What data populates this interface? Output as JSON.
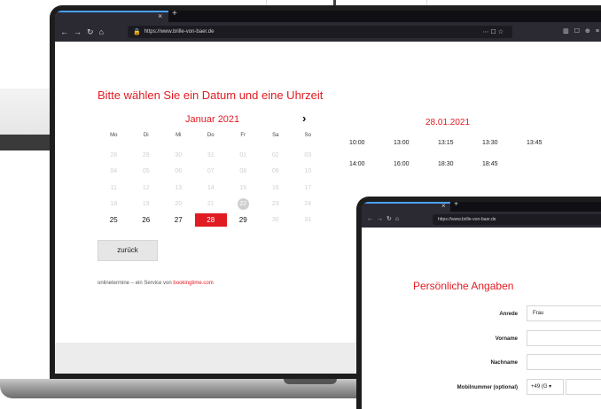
{
  "browser": {
    "url": "https://www.brille-von-baer.de",
    "tab_close": "×",
    "tab_plus": "+"
  },
  "calendar_page": {
    "heading": "Bitte wählen Sie ein Datum und eine Uhrzeit",
    "month_label": "Januar 2021",
    "next_symbol": "›",
    "weekdays": [
      "Mo",
      "Di",
      "Mi",
      "Do",
      "Fr",
      "Sa",
      "So"
    ],
    "weeks": [
      [
        "28",
        "29",
        "30",
        "31",
        "01",
        "02",
        "03"
      ],
      [
        "04",
        "05",
        "06",
        "07",
        "08",
        "09",
        "10"
      ],
      [
        "11",
        "12",
        "13",
        "14",
        "15",
        "16",
        "17"
      ],
      [
        "18",
        "19",
        "20",
        "21",
        "22",
        "23",
        "24"
      ],
      [
        "25",
        "26",
        "27",
        "28",
        "29",
        "30",
        "31"
      ]
    ],
    "back_button": "zurück",
    "service_text": "onlinetermine – ein Service von",
    "service_brand": "bookingtime.com",
    "selected_date": "28.01.2021",
    "times_row1": [
      "10:00",
      "13:00",
      "13:15",
      "13:30",
      "13:45"
    ],
    "times_row2": [
      "14:00",
      "16:00",
      "18:30",
      "18:45"
    ]
  },
  "form_page": {
    "url": "https://www.brille-von-baer.de",
    "title": "Persönliche Angaben",
    "fields": [
      {
        "label": "Anrede",
        "value": "Frau"
      },
      {
        "label": "Vorname",
        "value": ""
      },
      {
        "label": "Nachname",
        "value": ""
      },
      {
        "label": "Mobilnummer (optional)",
        "value": "+49 (G ▾"
      }
    ]
  },
  "colors": {
    "accent": "#e11b22",
    "browser_chrome": "#2b2a33",
    "tab_indicator": "#48a0ff"
  }
}
